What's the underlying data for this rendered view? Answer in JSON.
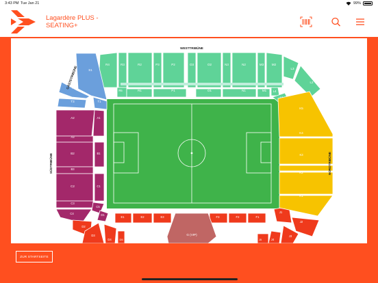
{
  "status_bar": {
    "time": "3:43 PM",
    "date": "Tue Jan 21",
    "battery": "99%"
  },
  "header": {
    "title": "Lagardère PLUS - SEATING+",
    "icons": [
      "barcode-icon",
      "search-icon",
      "menu-icon"
    ]
  },
  "stadium": {
    "stands": {
      "west": "WESTTRIBÜNE",
      "north": "NORDTRIBÜNE",
      "south": "SÜDTRIBÜNE",
      "guest": "GÄSTETRIBÜNE"
    },
    "vip_label": "G (VIP)",
    "colors": {
      "west": "#5fd398",
      "guest": "#6b9fdc",
      "south": "#a3286a",
      "north": "#f7c300",
      "east": "#ef3a1c",
      "vip": "#c06664",
      "pitch": "#3fb34a"
    },
    "blocks": {
      "R4": "R4",
      "R3": "R3",
      "R2": "R2",
      "P3": "P3",
      "P2": "P2",
      "O3": "O3",
      "O2": "O2",
      "N3": "N3",
      "N2": "N2",
      "M3": "M3",
      "M2": "M2",
      "L3": "L3",
      "L2": "L2",
      "R5": "R5",
      "R1": "R1",
      "P1": "P1",
      "O1": "O1",
      "N1": "N1",
      "M1": "M1",
      "L4": "L4",
      "L1": "L1",
      "S1": "S1",
      "T2": "T2",
      "T3": "T3",
      "T1": "T1",
      "A2": "A2",
      "A1": "A1",
      "A3": "A3",
      "B2": "B2",
      "B1": "B1",
      "B3": "B3",
      "C2": "C2",
      "C1": "C1",
      "C3": "C3",
      "C4": "C4",
      "C5": "C5",
      "D1": "D1",
      "D2": "D2",
      "D3": "D3",
      "D4": "D4",
      "D5": "D5",
      "K5": "K5",
      "K4": "K4",
      "K3": "K3",
      "K2": "K2",
      "K1": "K1",
      "E1": "E1",
      "E2": "E2",
      "E3": "E3",
      "F3": "F3",
      "F2": "F2",
      "F1": "F1",
      "J1": "J1",
      "J2": "J2",
      "J3": "J3",
      "J4": "J4",
      "J5": "J5"
    }
  },
  "footer": {
    "back_button": "ZUR STARTSEITE"
  }
}
